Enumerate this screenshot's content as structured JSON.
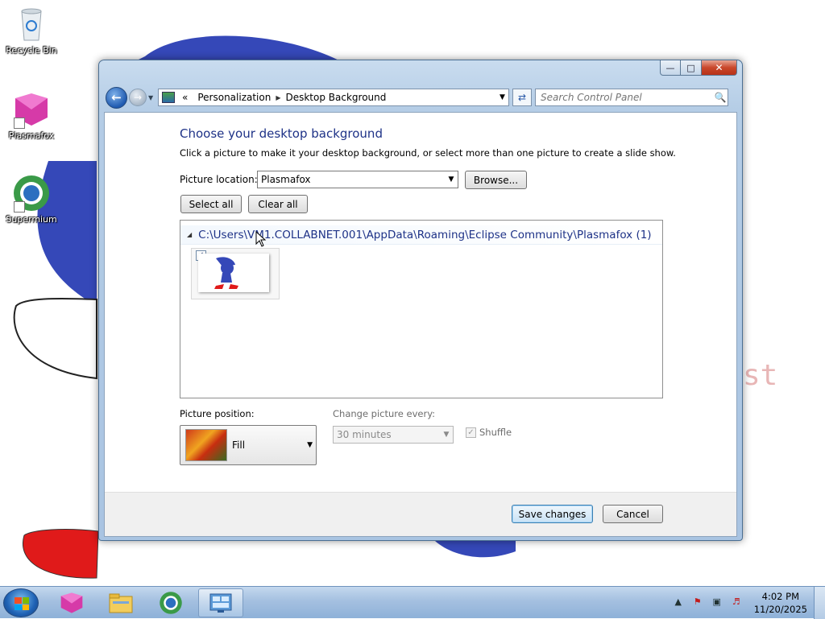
{
  "desktop": {
    "icons": [
      {
        "label": "Recycle Bin",
        "icon": "recycle-bin-icon"
      },
      {
        "label": "Plasmafox",
        "icon": "plasmafox-icon"
      },
      {
        "label": "Supermium",
        "icon": "supermium-icon"
      }
    ],
    "wallpaper_text": "st"
  },
  "window": {
    "address": {
      "overflow": "«",
      "segments": [
        "Personalization",
        "Desktop Background"
      ]
    },
    "search": {
      "placeholder": "Search Control Panel"
    },
    "title": "Choose your desktop background",
    "subtitle": "Click a picture to make it your desktop background, or select more than one picture to create a slide show.",
    "picture_location": {
      "label": "Picture location:",
      "value": "Plasmafox"
    },
    "browse_label": "Browse...",
    "select_all_label": "Select all",
    "clear_all_label": "Clear all",
    "group_header": "C:\\Users\\VM1.COLLABNET.001\\AppData\\Roaming\\Eclipse Community\\Plasmafox (1)",
    "thumbnail": {
      "checked": true
    },
    "picture_position": {
      "label": "Picture position:",
      "value": "Fill"
    },
    "change_picture": {
      "label": "Change picture every:",
      "value": "30 minutes"
    },
    "shuffle": {
      "label": "Shuffle",
      "checked": true
    },
    "save_label": "Save changes",
    "cancel_label": "Cancel"
  },
  "taskbar": {
    "clock_time": "4:02 PM",
    "clock_date": "11/20/2025"
  },
  "colors": {
    "title_blue": "#1e3287",
    "taskbar": "#a4c0e0",
    "close_red": "#c9472b"
  }
}
